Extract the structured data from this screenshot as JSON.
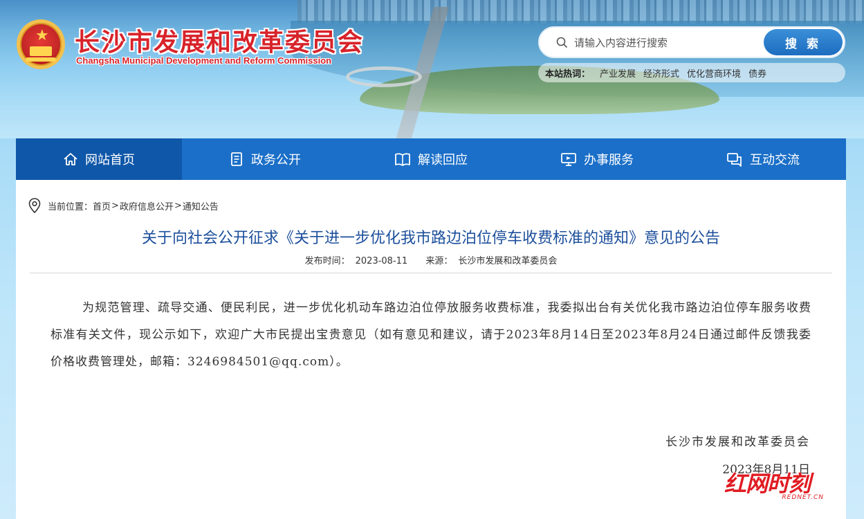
{
  "header": {
    "title": "长沙市发展和改革委员会",
    "subtitle": "Changsha Municipal Development and Reform Commission"
  },
  "search": {
    "placeholder": "请输入内容进行搜索",
    "button_label": "搜 索",
    "hot_label": "本站热词：",
    "hot_terms": [
      "产业发展",
      "经济形式",
      "优化营商环境",
      "债券"
    ]
  },
  "nav": {
    "items": [
      {
        "label": "网站首页",
        "icon": "home-icon"
      },
      {
        "label": "政务公开",
        "icon": "document-icon"
      },
      {
        "label": "解读回应",
        "icon": "book-icon"
      },
      {
        "label": "办事服务",
        "icon": "monitor-icon"
      },
      {
        "label": "互动交流",
        "icon": "chat-icon"
      }
    ]
  },
  "breadcrumb": {
    "prefix": "当前位置：",
    "items": [
      "首页",
      "政府信息公开",
      "通知公告"
    ],
    "separator": ">"
  },
  "article": {
    "title": "关于向社会公开征求《关于进一步优化我市路边泊位停车收费标准的通知》意见的公告",
    "published_label": "发布时间：",
    "published_date": "2023-08-11",
    "source_label": "来源：",
    "source": "长沙市发展和改革委员会",
    "body": "为规范管理、疏导交通、便民利民，进一步优化机动车路边泊位停放服务收费标准，我委拟出台有关优化我市路边泊位停车服务收费标准有关文件，现公示如下，欢迎广大市民提出宝贵意见（如有意见和建议，请于2023年8月14日至2023年8月24日通过邮件反馈我委价格收费管理处，邮箱：3246984501@qq.com）。",
    "signature_org": "长沙市发展和改革委员会",
    "signature_date": "2023年8月11日"
  },
  "watermark": {
    "main": "红网时刻",
    "sub": "REDNET.CN"
  },
  "colors": {
    "nav_bg": "#1b6fc8",
    "nav_active": "#0f57a8",
    "title_red": "#d8232a",
    "article_title": "#1c4f9c"
  }
}
